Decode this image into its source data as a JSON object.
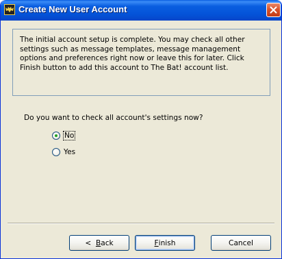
{
  "window": {
    "title": "Create New User Account"
  },
  "info": {
    "text": "The initial account setup is complete. You may check all other settings such as message templates, message management options and preferences right now or leave this for later. Click Finish button to add this account to The Bat! account list."
  },
  "question": {
    "text": "Do you want to check all account's settings now?"
  },
  "options": [
    {
      "label": "No",
      "checked": true
    },
    {
      "label": "Yes",
      "checked": false
    }
  ],
  "buttons": {
    "back": {
      "prefix": "<  ",
      "mnemonic": "B",
      "rest": "ack"
    },
    "finish": {
      "prefix": "",
      "mnemonic": "F",
      "rest": "inish"
    },
    "cancel": {
      "label": "Cancel"
    }
  },
  "colors": {
    "titlebar": "#0a5ee0",
    "window_bg": "#ece9d8",
    "radio_check": "#21a121"
  },
  "icons": {
    "title": "the-bat-bat-icon",
    "close": "close-x-icon"
  }
}
